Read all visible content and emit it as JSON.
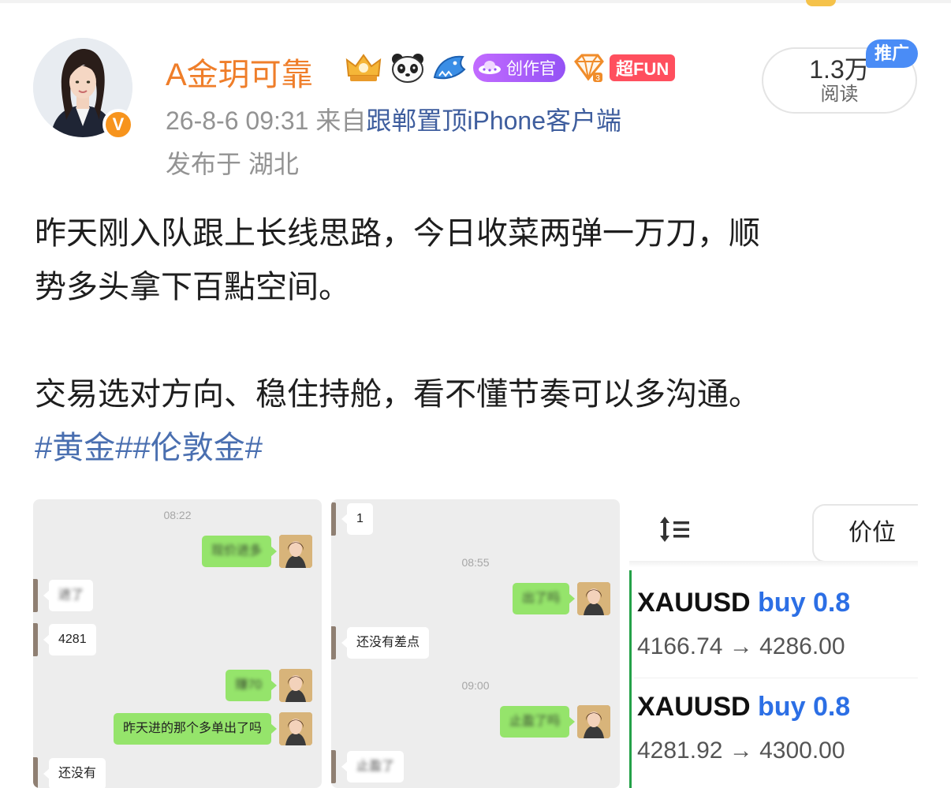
{
  "post": {
    "username": "A金玥可靠",
    "badges": {
      "crown_icon": "crown-icon",
      "panda_icon": "panda-icon",
      "shark_icon": "shark-icon",
      "creator_label": "创作官",
      "diamond_icon": "diamond-icon",
      "fun_label": "超FUN"
    },
    "verified_mark": "V",
    "timestamp": "26-8-6 09:31",
    "source_prefix": "来自",
    "source": "跟郸置顶iPhone客户端",
    "location": "发布于 湖北",
    "reads_count": "1.3万",
    "reads_label": "阅读",
    "ad_tag": "推广",
    "text_line1": "昨天刚入队跟上长线思路，今日收菜两弹一万刀，顺",
    "text_line2": "势多头拿下百點空间。",
    "text_line3": "交易选对方向、稳住持舱，看不懂节奏可以多沟通。",
    "hashtag1": "#黄金#",
    "hashtag2": "#伦敦金#"
  },
  "image1": {
    "time": "08:22",
    "msg1": "现价进多",
    "msg2": "进了",
    "msg3": "4281",
    "msg4": "赚70",
    "msg5": "昨天进的那个多单出了吗",
    "msg6": "还没有"
  },
  "image2": {
    "msg1": "1",
    "time1": "08:55",
    "msg2": "出了吗",
    "msg3": "还没有差点",
    "time2": "09:00",
    "msg4": "止盈了吗",
    "msg5": "止盈了"
  },
  "image3": {
    "sort_icon": "sort-icon",
    "price_label": "价位",
    "trades": [
      {
        "symbol": "XAUUSD",
        "direction": "buy",
        "volume": "0.8",
        "prices": "4166.74 → 4286.00"
      },
      {
        "symbol": "XAUUSD",
        "direction": "buy",
        "volume": "0.8",
        "prices": "4281.92 → 4300.00"
      }
    ]
  },
  "colors": {
    "username": "#ef7e2a",
    "link": "#3f5e9e",
    "hashtag": "#4a6fb0",
    "chat_green": "#95e46b",
    "buy_blue": "#2c6fe5",
    "ad_blue": "#4a8cf6"
  }
}
